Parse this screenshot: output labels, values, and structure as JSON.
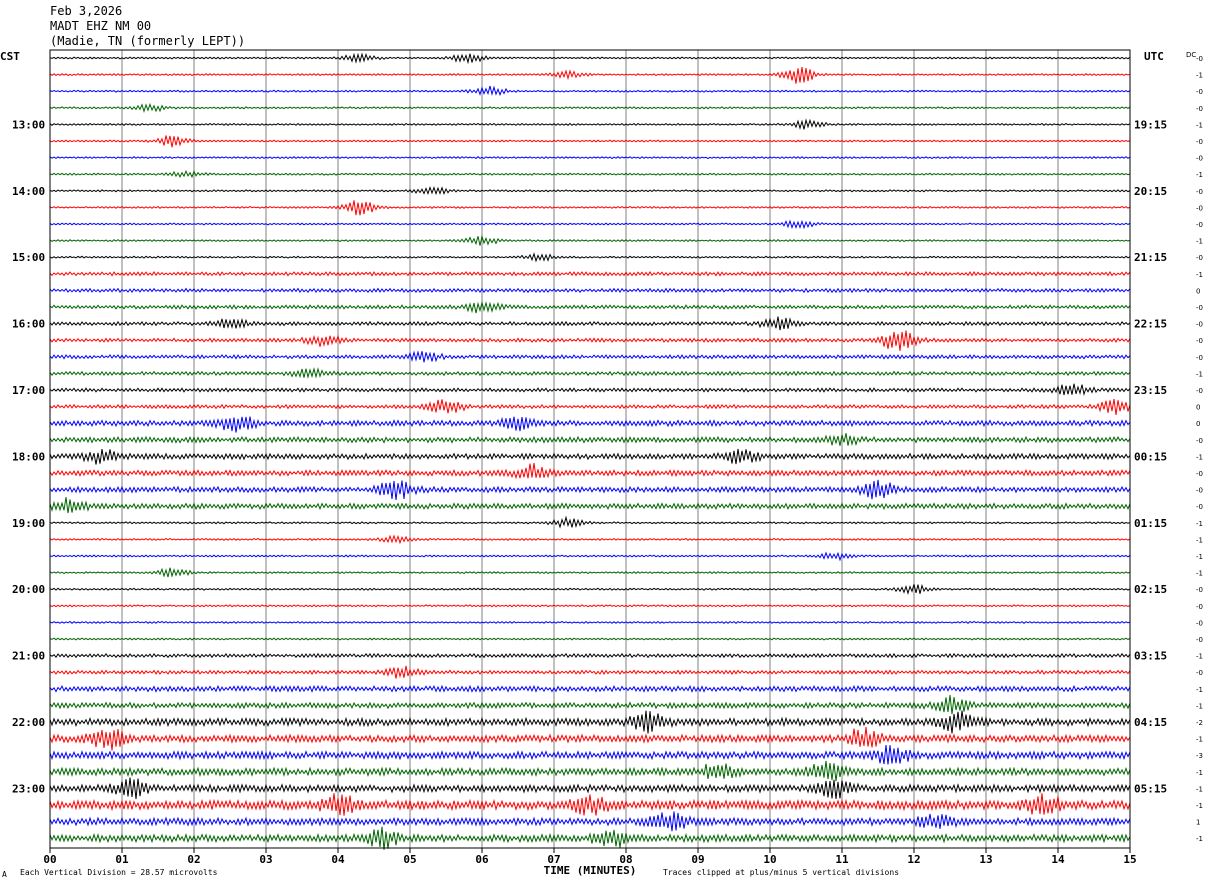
{
  "header": {
    "date": "Feb 3,2026",
    "station": "MADT EHZ NM 00",
    "location": "(Madie, TN (formerly LEPT))"
  },
  "left_axis_label": "CST",
  "right_axis_label": "UTC",
  "dc_label": "DC",
  "footer": {
    "scale_text": "Each Vertical Division =   28.57 microvolts",
    "xlabel": "TIME (MINUTES)",
    "clip_text": "Traces clipped at plus/minus 5 vertical divisions",
    "corner_mark": "A"
  },
  "colors": {
    "trace_cycle": [
      "#000000",
      "#ff0000",
      "#0000ff",
      "#006400"
    ],
    "grid": "#808080"
  },
  "chart_data": {
    "type": "line",
    "title": "",
    "xlabel": "TIME (MINUTES)",
    "xlim": [
      0,
      15
    ],
    "x_ticks": [
      "00",
      "01",
      "02",
      "03",
      "04",
      "05",
      "06",
      "07",
      "08",
      "09",
      "10",
      "11",
      "12",
      "13",
      "14",
      "15"
    ],
    "trace_count": 48,
    "trace_interval_minutes": 15,
    "left_hour_labels": [
      "13:00",
      "14:00",
      "15:00",
      "16:00",
      "17:00",
      "18:00",
      "19:00",
      "20:00",
      "21:00",
      "22:00",
      "23:00"
    ],
    "right_hour_labels": [
      "19:15",
      "20:15",
      "21:15",
      "22:15",
      "23:15",
      "00:15",
      "01:15",
      "02:15",
      "03:15",
      "04:15",
      "05:15"
    ],
    "dc_offsets": [
      "-0",
      "-1",
      "-0",
      "-0",
      "-1",
      "-0",
      "-0",
      "-1",
      "-0",
      "-0",
      "-0",
      "-1",
      "-0",
      "-1",
      "0",
      "-0",
      "-0",
      "-0",
      "-0",
      "-1",
      "-0",
      "0",
      "0",
      "-0",
      "-1",
      "-0",
      "-0",
      "-0",
      "-1",
      "-1",
      "-1",
      "-1",
      "-0",
      "-0",
      "-0",
      "-0",
      "-1",
      "-0",
      "-1",
      "-1",
      "-2",
      "-1",
      "-3",
      "-1",
      "-1",
      "-1",
      "1",
      "-1"
    ],
    "trace_activity": [
      1,
      1,
      1,
      1,
      1,
      1,
      1,
      1,
      1,
      1,
      1,
      1,
      1,
      2,
      2,
      2,
      2,
      2,
      2,
      2,
      2,
      2,
      3,
      3,
      3,
      3,
      3,
      3,
      1,
      1,
      1,
      1,
      1,
      1,
      1,
      1,
      2,
      2,
      3,
      3,
      4,
      4,
      4,
      4,
      4,
      5,
      4,
      4
    ],
    "events": [
      {
        "trace": 0,
        "minute": 4.3,
        "amp": 2.0
      },
      {
        "trace": 0,
        "minute": 5.8,
        "amp": 2.0
      },
      {
        "trace": 1,
        "minute": 10.4,
        "amp": 4.0
      },
      {
        "trace": 1,
        "minute": 7.2,
        "amp": 1.3
      },
      {
        "trace": 2,
        "minute": 6.1,
        "amp": 2.0
      },
      {
        "trace": 3,
        "minute": 1.4,
        "amp": 1.5
      },
      {
        "trace": 4,
        "minute": 10.5,
        "amp": 2.2
      },
      {
        "trace": 5,
        "minute": 1.7,
        "amp": 2.5
      },
      {
        "trace": 7,
        "minute": 1.9,
        "amp": 1.5
      },
      {
        "trace": 8,
        "minute": 5.3,
        "amp": 1.8
      },
      {
        "trace": 9,
        "minute": 4.3,
        "amp": 3.5
      },
      {
        "trace": 10,
        "minute": 10.4,
        "amp": 1.8
      },
      {
        "trace": 11,
        "minute": 6.0,
        "amp": 2.0
      },
      {
        "trace": 12,
        "minute": 6.8,
        "amp": 1.5
      },
      {
        "trace": 15,
        "minute": 6.0,
        "amp": 2.5
      },
      {
        "trace": 16,
        "minute": 10.1,
        "amp": 2.5
      },
      {
        "trace": 16,
        "minute": 2.5,
        "amp": 2.0
      },
      {
        "trace": 17,
        "minute": 11.8,
        "amp": 6.0
      },
      {
        "trace": 17,
        "minute": 3.8,
        "amp": 2.5
      },
      {
        "trace": 18,
        "minute": 5.2,
        "amp": 2.0
      },
      {
        "trace": 19,
        "minute": 3.6,
        "amp": 2.0
      },
      {
        "trace": 20,
        "minute": 14.2,
        "amp": 2.5
      },
      {
        "trace": 21,
        "minute": 5.5,
        "amp": 3.5
      },
      {
        "trace": 21,
        "minute": 14.8,
        "amp": 3.0
      },
      {
        "trace": 22,
        "minute": 2.6,
        "amp": 5.0
      },
      {
        "trace": 22,
        "minute": 6.5,
        "amp": 2.5
      },
      {
        "trace": 23,
        "minute": 11.0,
        "amp": 2.0
      },
      {
        "trace": 24,
        "minute": 0.7,
        "amp": 3.0
      },
      {
        "trace": 24,
        "minute": 9.6,
        "amp": 3.0
      },
      {
        "trace": 25,
        "minute": 6.7,
        "amp": 3.5
      },
      {
        "trace": 26,
        "minute": 4.8,
        "amp": 4.5
      },
      {
        "trace": 26,
        "minute": 11.5,
        "amp": 4.0
      },
      {
        "trace": 27,
        "minute": 0.3,
        "amp": 3.5
      },
      {
        "trace": 28,
        "minute": 7.2,
        "amp": 2.2
      },
      {
        "trace": 29,
        "minute": 4.8,
        "amp": 1.5
      },
      {
        "trace": 30,
        "minute": 10.9,
        "amp": 1.8
      },
      {
        "trace": 31,
        "minute": 1.7,
        "amp": 2.0
      },
      {
        "trace": 32,
        "minute": 12.0,
        "amp": 2.0
      },
      {
        "trace": 37,
        "minute": 4.9,
        "amp": 2.5
      },
      {
        "trace": 39,
        "minute": 12.5,
        "amp": 4.5
      },
      {
        "trace": 40,
        "minute": 8.3,
        "amp": 4.0
      },
      {
        "trace": 40,
        "minute": 12.6,
        "amp": 4.5
      },
      {
        "trace": 41,
        "minute": 0.8,
        "amp": 4.5
      },
      {
        "trace": 41,
        "minute": 11.3,
        "amp": 4.5
      },
      {
        "trace": 42,
        "minute": 11.7,
        "amp": 4.0
      },
      {
        "trace": 43,
        "minute": 9.3,
        "amp": 4.5
      },
      {
        "trace": 43,
        "minute": 10.8,
        "amp": 5.0
      },
      {
        "trace": 44,
        "minute": 1.1,
        "amp": 4.0
      },
      {
        "trace": 44,
        "minute": 10.9,
        "amp": 3.5
      },
      {
        "trace": 45,
        "minute": 4.0,
        "amp": 4.5
      },
      {
        "trace": 45,
        "minute": 7.5,
        "amp": 4.5
      },
      {
        "trace": 45,
        "minute": 13.8,
        "amp": 4.5
      },
      {
        "trace": 46,
        "minute": 8.6,
        "amp": 4.0
      },
      {
        "trace": 46,
        "minute": 12.3,
        "amp": 3.5
      },
      {
        "trace": 47,
        "minute": 4.6,
        "amp": 4.0
      },
      {
        "trace": 47,
        "minute": 7.8,
        "amp": 4.5
      }
    ]
  }
}
